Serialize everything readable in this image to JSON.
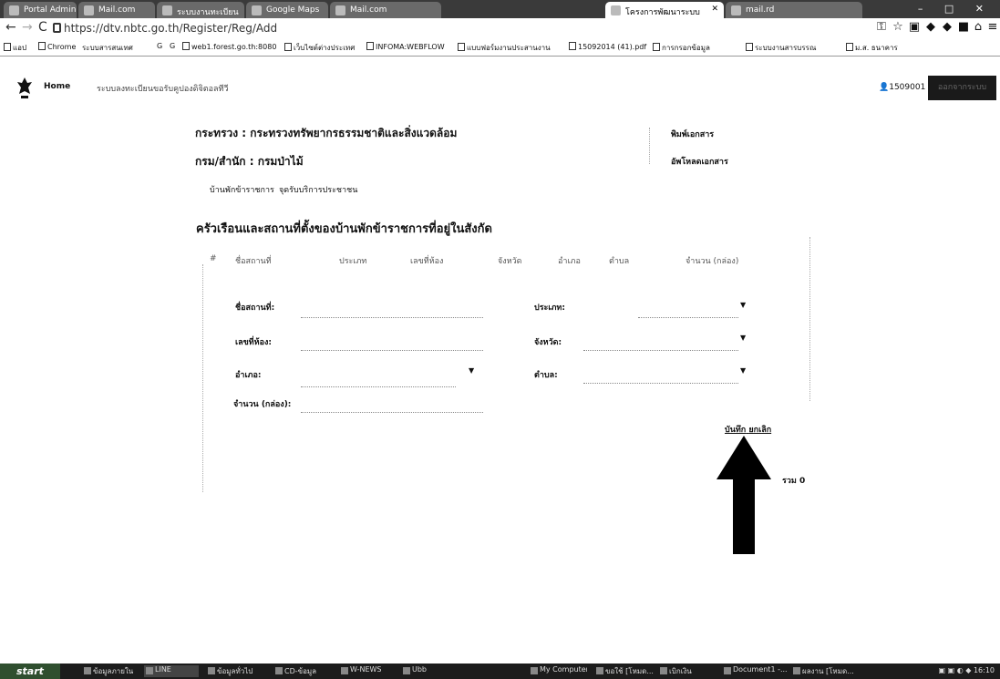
{
  "browser": {
    "tabs": [
      {
        "label": "Portal Administration Tag"
      },
      {
        "label": "Mail.com"
      },
      {
        "label": "ระบบงานทะเบียน"
      },
      {
        "label": "Google Maps"
      },
      {
        "label": "Mail.com"
      },
      {
        "label": "โครงการพัฒนาระบบ"
      },
      {
        "label": "mail.rd"
      }
    ],
    "window_controls": "– □ ✕",
    "url": "https://dtv.nbtc.go.th/Register/Reg/Add",
    "bookmarks": [
      "แอป",
      "Chrome",
      "ระบบสารสนเทศ",
      "G",
      "G",
      "web1.forest.go.th:8080",
      "เว็บไซต์ต่างประเทศ",
      "INFOMA:WEBFLOW",
      "แบบฟอร์มงานประสานงาน",
      "15092014 (41).pdf",
      "การกรอกข้อมูล",
      "ระบบงานสารบรรณ",
      "ม.ส. ธนาคาร"
    ]
  },
  "header": {
    "home": "Home",
    "title": "ระบบลงทะเบียนขอรับคูปองดิจิตอลทีวี",
    "user_id": "1509001",
    "logout": "ออกจากระบบ"
  },
  "info": {
    "ministry": "กระทรวง :  กระทรวงทรัพยากรธรรมชาติและสิ่งแวดล้อม",
    "department": "กรม/สำนัก : กรมป่าไม้",
    "print_link": "พิมพ์เอกสาร",
    "upload_link": "อัพโหลดเอกสาร"
  },
  "subnav": {
    "item1": "บ้านพักข้าราชการ",
    "item2": "จุดรับบริการประชาชน"
  },
  "section": {
    "title": "ครัวเรือนและสถานที่ตั้งของบ้านพักข้าราชการที่อยู่ในสังกัด"
  },
  "table": {
    "headers": [
      "#",
      "ชื่อสถานที่",
      "ประเภท",
      "เลขที่ห้อง",
      "จังหวัด",
      "อำเภอ",
      "ตำบล",
      "จำนวน (กล่อง)"
    ]
  },
  "form": {
    "place_name": "ชื่อสถานที่:",
    "type": "ประเภท:",
    "room_no": "เลขที่ห้อง:",
    "province": "จังหวัด:",
    "district": "อำเภอ:",
    "subdistrict": "ตำบล:",
    "quantity": "จำนวน (กล่อง):"
  },
  "actions": {
    "save": "บันทึก",
    "cancel": "ยกเลิก",
    "total": "รวม 0"
  },
  "taskbar": {
    "start": "start",
    "items": [
      "ข้อมูลภายใน",
      "LINE",
      "ข้อมูลทั่วไป",
      "CD-ข้อมูล",
      "W-NEWS",
      "Ubb",
      "My Computer",
      "ขอใช้ [โหมด...",
      "เบิกเงิน",
      "Document1 -...",
      "ผลงาน [โหมด..."
    ],
    "clock": "16:10"
  }
}
